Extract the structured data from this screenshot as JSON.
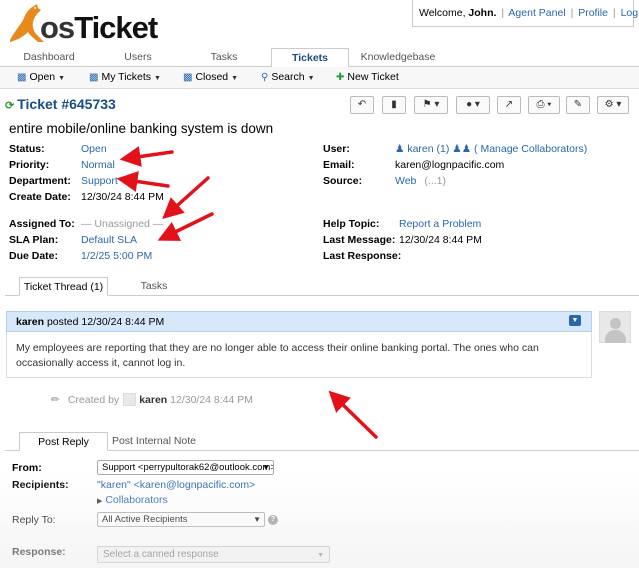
{
  "logo": {
    "text_os": "os",
    "text_ticket": "Ticket"
  },
  "user_bar": {
    "welcome": "Welcome,",
    "name": "John.",
    "agent_panel": "Agent Panel",
    "profile": "Profile",
    "logout": "Log Out",
    "sep": "|"
  },
  "nav": [
    "Dashboard",
    "Users",
    "Tasks",
    "Tickets",
    "Knowledgebase"
  ],
  "subnav": {
    "open": "Open",
    "my_tickets": "My Tickets",
    "closed": "Closed",
    "search": "Search",
    "new_ticket": "New Ticket"
  },
  "ticket": {
    "number": "Ticket #645733",
    "subject": "entire mobile/online banking system is down"
  },
  "left_fields": {
    "status_label": "Status:",
    "status": "Open",
    "priority_label": "Priority:",
    "priority": "Normal",
    "department_label": "Department:",
    "department": "Support",
    "create_label": "Create Date:",
    "create": "12/30/24 8:44 PM",
    "assigned_label": "Assigned To:",
    "assigned": "— Unassigned —",
    "sla_label": "SLA Plan:",
    "sla": "Default SLA",
    "due_label": "Due Date:",
    "due": "1/2/25 5:00 PM"
  },
  "right_fields": {
    "user_label": "User:",
    "user": "karen (1)",
    "manage": "( Manage Collaborators)",
    "email_label": "Email:",
    "email": "karen@lognpacific.com",
    "source_label": "Source:",
    "source": "Web",
    "source_extra": "(...1)",
    "topic_label": "Help Topic:",
    "topic": "Report a Problem",
    "last_msg_label": "Last Message:",
    "last_msg": "12/30/24 8:44 PM",
    "last_resp_label": "Last Response:"
  },
  "thread_tabs": {
    "thread": "Ticket Thread (1)",
    "tasks": "Tasks"
  },
  "thread_entry": {
    "poster": "karen",
    "posted": "posted 12/30/24 8:44 PM",
    "body": "My employees are reporting that they are no longer able to access their online banking portal. The ones who can occasionally access it, cannot log in."
  },
  "created_by": {
    "label": "Created by",
    "name": "karen",
    "time": "12/30/24 8:44 PM"
  },
  "reply_tabs": {
    "post_reply": "Post Reply",
    "internal": "Post Internal Note"
  },
  "reply_form": {
    "from_label": "From:",
    "from_value": "Support <perrypultorak62@outlook.com>",
    "recipients_label": "Recipients:",
    "recipient": "\"karen\" <karen@lognpacific.com>",
    "collaborators": "Collaborators",
    "reply_to_label": "Reply To:",
    "reply_to_value": "All Active Recipients",
    "response_label": "Response:",
    "canned_placeholder": "Select a canned response"
  },
  "colors": {
    "link": "#2a67ac",
    "title": "#184e81",
    "thread_head": "#d7e8fb",
    "arrow": "#e3121a"
  }
}
